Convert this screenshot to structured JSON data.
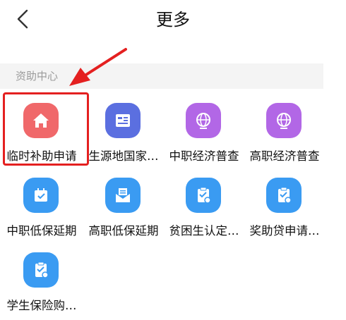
{
  "header": {
    "back_icon": "chevron-left-icon",
    "title": "更多"
  },
  "section": {
    "label": "资助中心"
  },
  "items": [
    {
      "label": "临时补助申请",
      "icon": "home-icon",
      "color": "#f0686a"
    },
    {
      "label": "生源地国家…",
      "icon": "book-icon",
      "color": "#5b6fe0"
    },
    {
      "label": "中职经济普查",
      "icon": "globe-icon",
      "color": "#b267e6"
    },
    {
      "label": "高职经济普查",
      "icon": "globe-icon",
      "color": "#b267e6"
    },
    {
      "label": "中职低保延期",
      "icon": "calendar-icon",
      "color": "#3a9bf2"
    },
    {
      "label": "高职低保延期",
      "icon": "envelope-icon",
      "color": "#3a9bf2"
    },
    {
      "label": "贫困生认定…",
      "icon": "clipboard-icon",
      "color": "#3a9bf2"
    },
    {
      "label": "奖助贷申请…",
      "icon": "clipboard-icon",
      "color": "#3a9bf2"
    },
    {
      "label": "学生保险购…",
      "icon": "clipboard-icon",
      "color": "#3a9bf2"
    }
  ],
  "annotation": {
    "highlight_color": "#e42020"
  }
}
